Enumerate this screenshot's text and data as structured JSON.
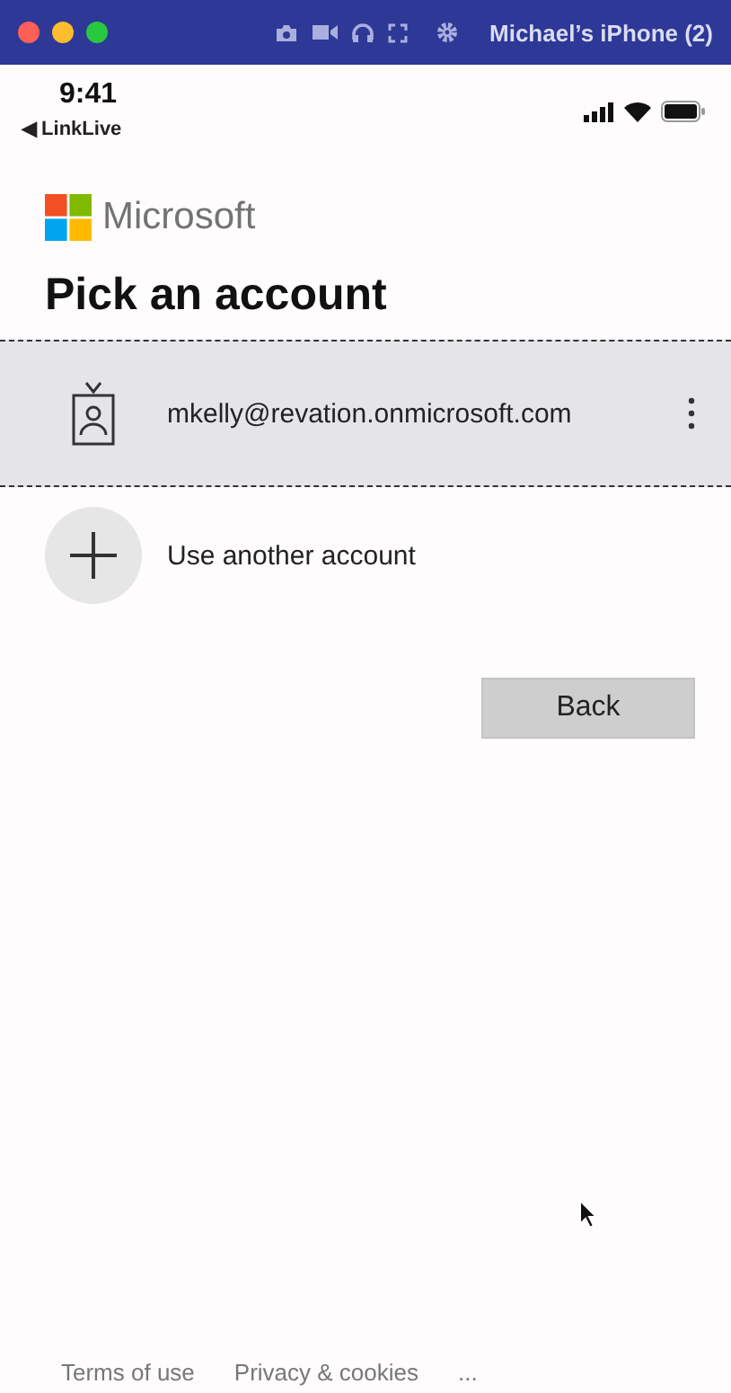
{
  "window": {
    "title": "Michael’s iPhone (2)"
  },
  "status_bar": {
    "time": "9:41",
    "back_app": "◀ LinkLive"
  },
  "brand": {
    "name": "Microsoft"
  },
  "heading": "Pick an account",
  "accounts": [
    {
      "kind": "account",
      "label": "mkelly@revation.onmicrosoft.com",
      "selected": true
    },
    {
      "kind": "add",
      "label": "Use another account",
      "selected": false
    }
  ],
  "back_button": "Back",
  "footer": [
    "Terms of use",
    "Privacy & cookies",
    "..."
  ]
}
